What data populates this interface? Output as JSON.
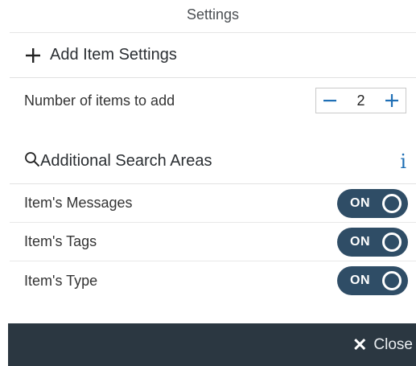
{
  "header": {
    "title": "Settings"
  },
  "add_item_section": {
    "icon": "plus-icon",
    "label": "Add Item Settings"
  },
  "items_count": {
    "label": "Number of items to add",
    "value": "2",
    "decrement_icon": "minus-icon",
    "increment_icon": "plus-icon"
  },
  "search_section": {
    "icon": "search-icon",
    "label": "Additional Search Areas",
    "info_glyph": "i"
  },
  "toggles": [
    {
      "label": "Item's Messages",
      "state": "ON"
    },
    {
      "label": "Item's Tags",
      "state": "ON"
    },
    {
      "label": "Item's Type",
      "state": "ON"
    }
  ],
  "footer": {
    "close_icon": "close-icon",
    "close_glyph": "✕",
    "close_label": "Close"
  },
  "colors": {
    "toggle_bg": "#2f4d66",
    "footer_bg": "#2b3741",
    "accent_blue": "#1f6fb5"
  }
}
